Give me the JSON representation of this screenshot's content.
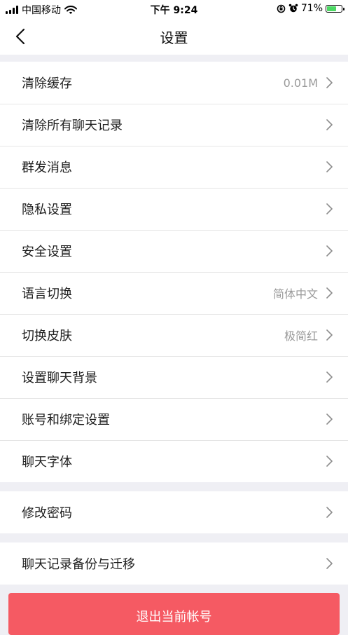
{
  "status_bar": {
    "carrier": "中国移动",
    "time": "下午 9:24",
    "battery_text": "71%",
    "battery_level": 0.71,
    "icons": [
      "signal-icon",
      "wifi-icon",
      "rotation-lock-icon",
      "alarm-icon",
      "battery-icon"
    ]
  },
  "nav": {
    "title": "设置",
    "back_icon": "back-chevron-icon"
  },
  "group1": [
    {
      "label": "清除缓存",
      "value": "0.01M"
    },
    {
      "label": "清除所有聊天记录",
      "value": ""
    },
    {
      "label": "群发消息",
      "value": ""
    },
    {
      "label": "隐私设置",
      "value": ""
    },
    {
      "label": "安全设置",
      "value": ""
    },
    {
      "label": "语言切换",
      "value": "简体中文"
    },
    {
      "label": "切换皮肤",
      "value": "极简红"
    },
    {
      "label": "设置聊天背景",
      "value": ""
    },
    {
      "label": "账号和绑定设置",
      "value": ""
    },
    {
      "label": "聊天字体",
      "value": ""
    }
  ],
  "group2": [
    {
      "label": "修改密码",
      "value": ""
    }
  ],
  "group3": [
    {
      "label": "聊天记录备份与迁移",
      "value": ""
    }
  ],
  "logout_label": "退出当前帐号",
  "colors": {
    "background": "#efeff4",
    "logout_button": "#f55a63",
    "value_text": "#9a9a9a",
    "battery_fill": "#4cd964"
  }
}
